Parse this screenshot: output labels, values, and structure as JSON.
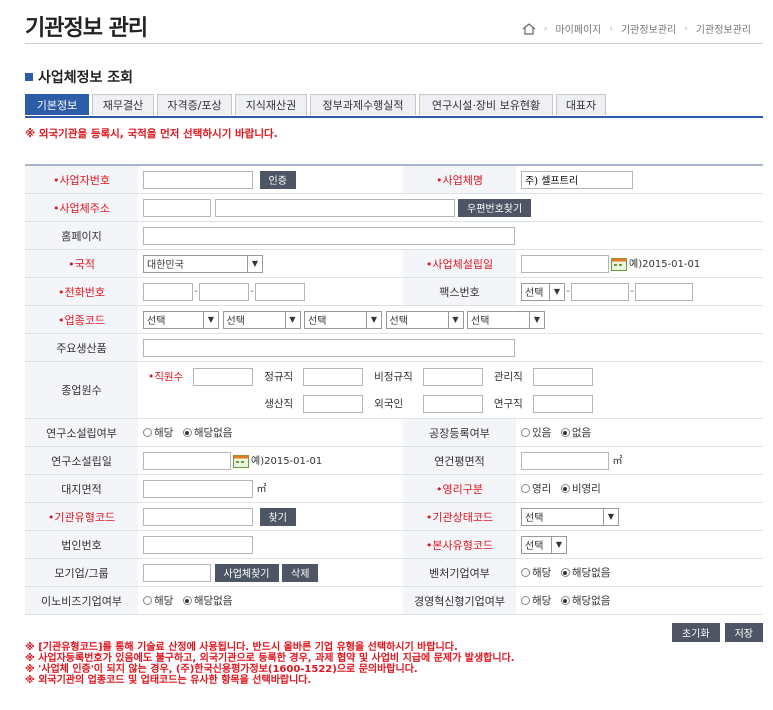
{
  "page": {
    "title": "기관정보 관리",
    "breadcrumb": [
      "마이페이지",
      "기관정보관리",
      "기관정보관리"
    ],
    "section_title": "사업체정보 조회"
  },
  "tabs": [
    {
      "label": "기본정보",
      "active": true
    },
    {
      "label": "재무결산"
    },
    {
      "label": "자격증/포상"
    },
    {
      "label": "지식재산권"
    },
    {
      "label": "정부과제수행실적"
    },
    {
      "label": "연구시설·장비 보유현황"
    },
    {
      "label": "대표자"
    }
  ],
  "warning_top": "※ 외국기관을 등록시, 국적을 먼저 선택하시기 바랍니다.",
  "form": {
    "biz_no_label": "•사업자번호",
    "auth_button": "인증",
    "biz_name_label": "•사업체명",
    "biz_name_value": "주) 셀프트리",
    "biz_addr_label": "•사업체주소",
    "zip_button": "우편번호찾기",
    "homepage_label": "홈페이지",
    "nation_label": "•국적",
    "nation_value": "대한민국",
    "found_date_label": "•사업체설립일",
    "date_example": "예)2015-01-01",
    "phone_label": "•전화번호",
    "fax_label": "팩스번호",
    "fax_select": "선택",
    "industry_label": "•업종코드",
    "industry_selects": [
      "선택",
      "선택",
      "선택",
      "선택",
      "선택"
    ],
    "products_label": "주요생산품",
    "employees_label": "종업원수",
    "emp_total_label": "•직원수",
    "emp_regular_label": "정규직",
    "emp_nonregular_label": "비정규직",
    "emp_manager_label": "관리직",
    "emp_production_label": "생산직",
    "emp_foreign_label": "외국인",
    "emp_research_label": "연구직",
    "lab_label": "연구소설립여부",
    "lab_opt_yes": "해당",
    "lab_opt_no": "해당없음",
    "factory_label": "공장등록여부",
    "factory_opt_yes": "있음",
    "factory_opt_no": "없음",
    "lab_date_label": "연구소설립일",
    "floor_area_label": "연건평면적",
    "unit_m2": "㎡",
    "land_area_label": "대지면적",
    "profit_label": "•영리구분",
    "profit_opt_yes": "영리",
    "profit_opt_no": "비영리",
    "org_type_label": "•기관유형코드",
    "find_button": "찾기",
    "org_status_label": "•기관상태코드",
    "org_status_select": "선택",
    "corp_no_label": "법인번호",
    "hq_type_label": "•본사유형코드",
    "hq_type_select": "선택",
    "group_label": "모기업/그룹",
    "biz_find_button": "사업체찾기",
    "delete_button": "삭제",
    "venture_label": "벤처기업여부",
    "venture_yes": "해당",
    "venture_no": "해당없음",
    "innobiz_label": "이노비즈기업여부",
    "innobiz_yes": "해당",
    "innobiz_no": "해당없음",
    "mainbiz_label": "경영혁신형기업여부",
    "mainbiz_yes": "해당",
    "mainbiz_no": "해당없음"
  },
  "buttons": {
    "reset": "초기화",
    "save": "저장"
  },
  "notes": [
    "※ [기관유형코드]를 통해 기술료 산정에 사용됩니다. 반드시 올바른 기업 유형을 선택하시기 바랍니다.",
    "※ 사업자등록번호가 있음에도 불구하고, 외국기관으로 등록한 경우, 과제 협약 및 사업비 지급에 문제가 발생합니다.",
    "※ '사업체 인증'이 되지 않는 경우, (주)한국신용평가정보(1600-1522)으로 문의바랍니다.",
    "※ 외국기관의 업종코드 및 업태코드는 유사한 항목을 선택바랍니다."
  ]
}
